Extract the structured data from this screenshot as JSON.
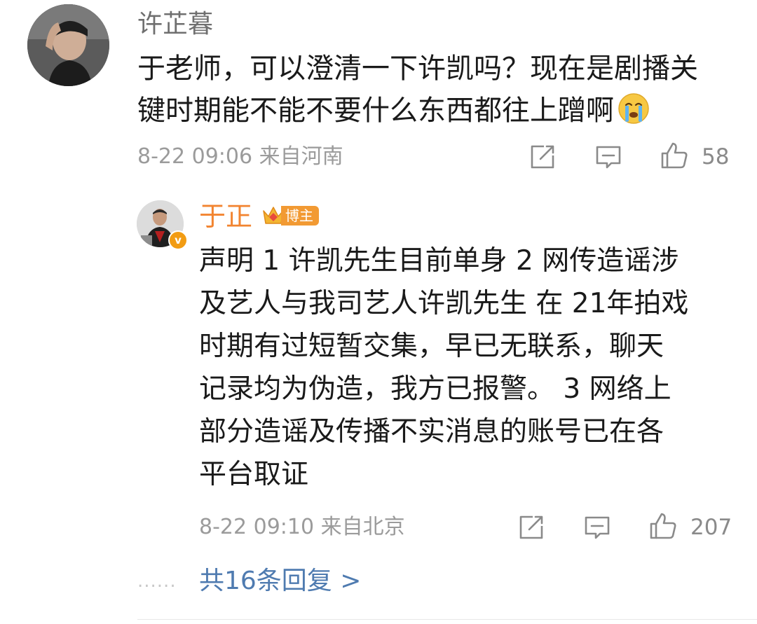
{
  "main_comment": {
    "username": "许芷暮",
    "lines": [
      "于老师，可以澄清一下许凯吗？现在是剧播关",
      "键时期能不能不要什么东西都往上蹭啊"
    ],
    "emoji": "crying-face",
    "timestamp": "8-22 09:06",
    "location": "来自河南",
    "like_count": "58"
  },
  "reply": {
    "username": "于正",
    "badge_label": "博主",
    "verified_mark": "v",
    "lines": [
      "声明 1 许凯先生目前单身 2 网传造谣涉",
      "及艺人与我司艺人许凯先生 在 21年拍戏",
      "时期有过短暂交集，早已无联系，聊天",
      "记录均为伪造，我方已报警。 3 网络上",
      "部分造谣及传播不实消息的账号已在各",
      "平台取证"
    ],
    "timestamp": "8-22 09:10",
    "location": "来自北京",
    "like_count": "207"
  },
  "more_replies": {
    "dots": "......",
    "label": "共16条回复 >"
  },
  "colors": {
    "username_gray": "#6f6f6f",
    "reply_username_orange": "#f28430",
    "badge_orange": "#f29a33",
    "meta_gray": "#9b9b9b",
    "link_blue": "#4f7bb0"
  },
  "icons": [
    "share-icon",
    "comment-icon",
    "like-icon",
    "crown-icon",
    "verified-badge-icon",
    "crying-face-emoji"
  ]
}
